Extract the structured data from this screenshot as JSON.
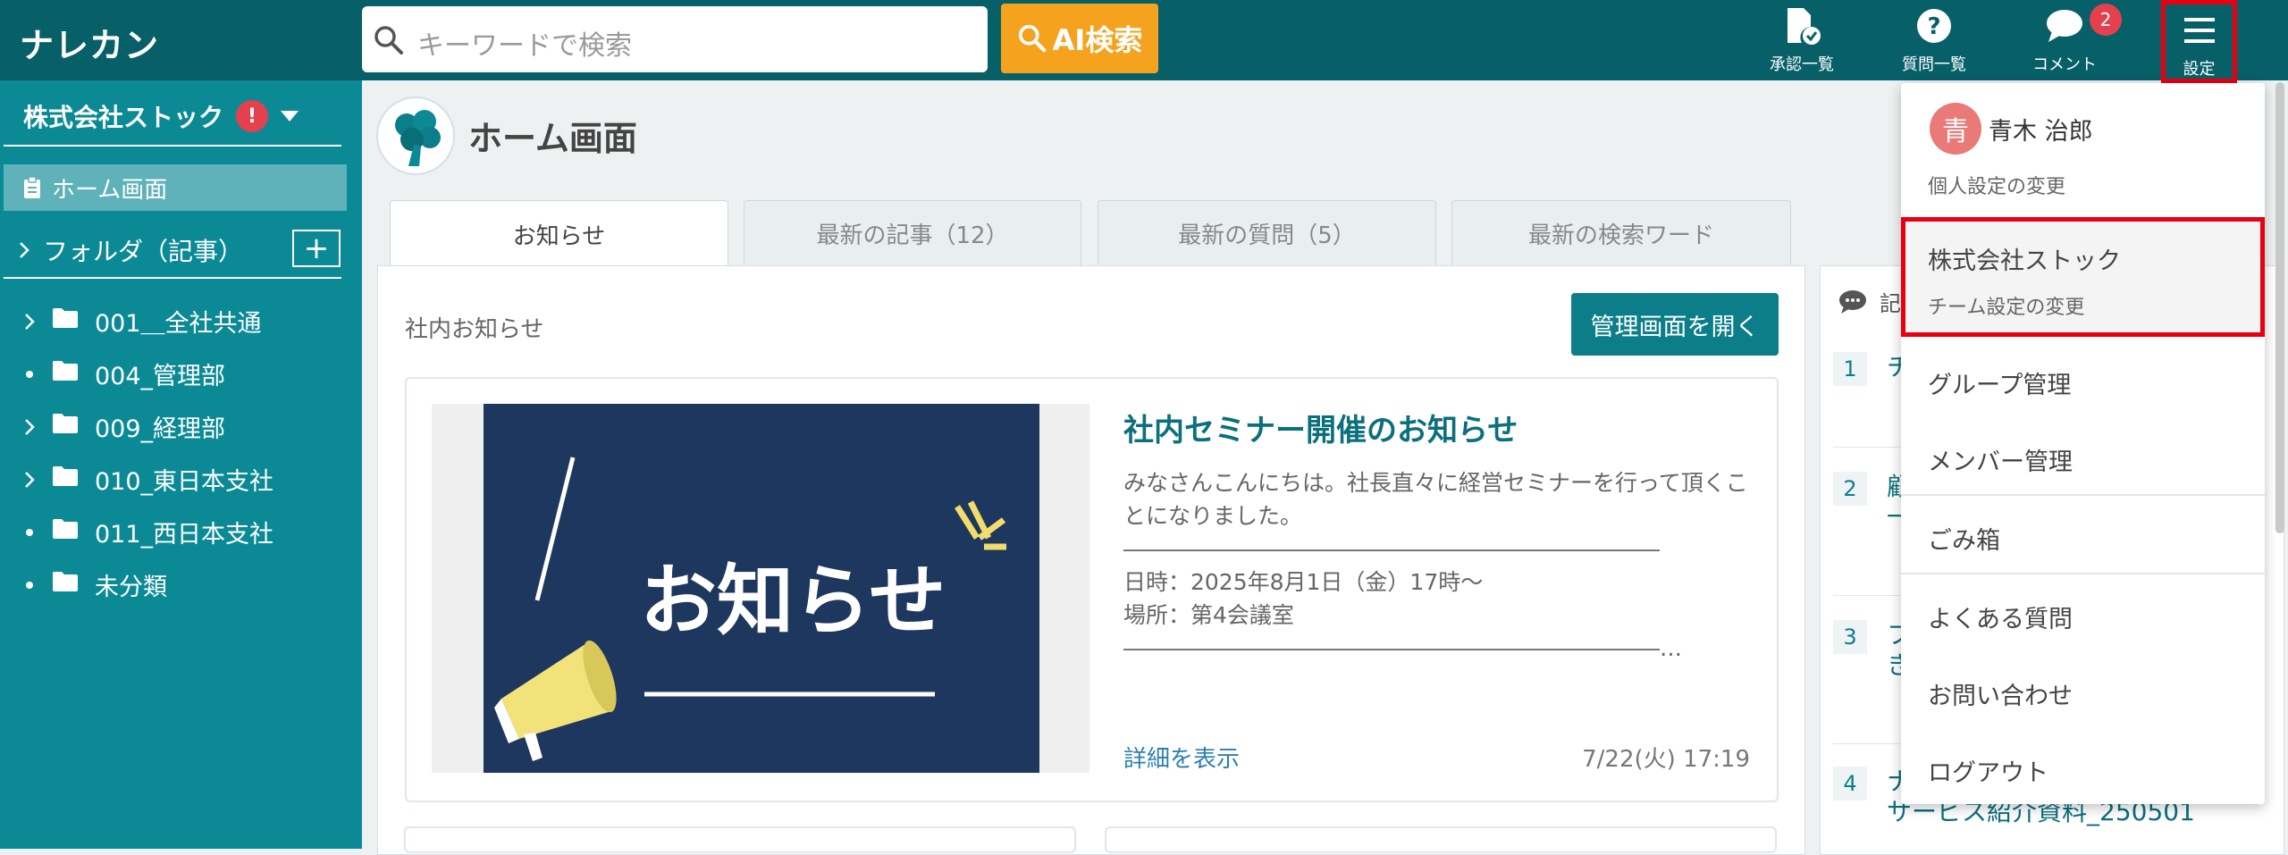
{
  "header": {
    "logo": "ナレカン",
    "search_placeholder": "キーワードで検索",
    "ai_search_label": "AI検索",
    "nav": [
      {
        "label": "承認一覧",
        "icon": "approval-doc-icon"
      },
      {
        "label": "質問一覧",
        "icon": "question-icon"
      },
      {
        "label": "コメント",
        "icon": "comment-icon",
        "badge": "2"
      },
      {
        "label": "設定",
        "icon": "hamburger-menu-icon"
      }
    ]
  },
  "sidebar": {
    "company": "株式会社ストック",
    "alert": "!",
    "home": "ホーム画面",
    "folder_header": "フォルダ（記事）",
    "add": "+",
    "folders": [
      {
        "label": "001＿全社共通",
        "expandable": true
      },
      {
        "label": "004_管理部",
        "expandable": false
      },
      {
        "label": "009_経理部",
        "expandable": true
      },
      {
        "label": "010_東日本支社",
        "expandable": true
      },
      {
        "label": "011_西日本支社",
        "expandable": false
      },
      {
        "label": "未分類",
        "expandable": false
      }
    ]
  },
  "main": {
    "title": "ホーム画面",
    "tabs": [
      "お知らせ",
      "最新の記事（12）",
      "最新の質問（5）",
      "最新の検索ワード"
    ],
    "section_label": "社内お知らせ",
    "admin_button": "管理画面を開く",
    "news": {
      "thumb_text": "お知らせ",
      "title": "社内セミナー開催のお知らせ",
      "body": "みなさんこんにちは。社長直々に経営セミナーを行って頂くことになりました。\n――――――――――――――――――――――――\n日時：2025年8月1日（金）17時〜\n場所：第4会議室\n――――――――――――――――――――――――…",
      "link": "詳細を表示",
      "date": "7/22(火) 17:19"
    }
  },
  "right_panel": {
    "header_fragment": "記",
    "items": [
      {
        "num": "1",
        "text": "チ"
      },
      {
        "num": "2",
        "text": "顧\n一"
      },
      {
        "num": "3",
        "text": "フ\nき"
      },
      {
        "num": "4",
        "text": "ナ\nサービス紹介資料_250501"
      }
    ]
  },
  "dropdown": {
    "avatar": "青",
    "user_name": "青木 治郎",
    "personal_settings": "個人設定の変更",
    "team_name": "株式会社ストック",
    "team_settings": "チーム設定の変更",
    "group_mgmt": "グループ管理",
    "member_mgmt": "メンバー管理",
    "trash": "ごみ箱",
    "faq": "よくある質問",
    "contact": "お問い合わせ",
    "logout": "ログアウト"
  },
  "colors": {
    "header": "#075f68",
    "sidebar": "#0b8a96",
    "accent": "#f5a31f",
    "badge": "#e5404d",
    "highlight": "#e60012"
  }
}
